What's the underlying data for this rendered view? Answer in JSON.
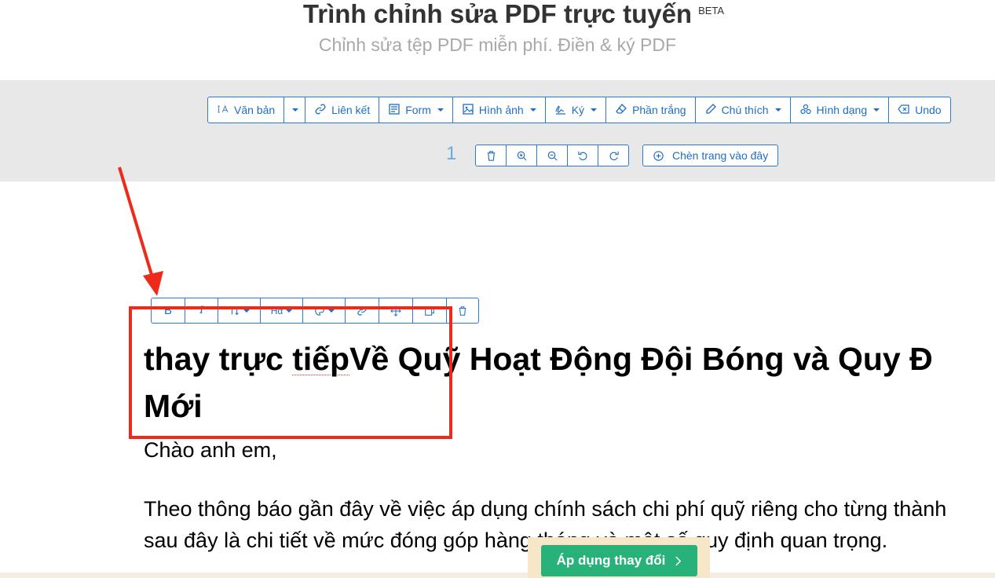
{
  "header": {
    "title": "Trình chỉnh sửa PDF trực tuyến",
    "beta": "BETA",
    "subtitle": "Chỉnh sửa tệp PDF miễn phí. Điền & ký PDF"
  },
  "toolbar": {
    "items": [
      {
        "label": "Văn bản",
        "icon": "text-cursor-icon"
      },
      {
        "label": "",
        "icon": "chevron-down-icon"
      },
      {
        "label": "Liên kết",
        "icon": "link-icon"
      },
      {
        "label": "Form",
        "icon": "form-icon"
      },
      {
        "label": "Hình ảnh",
        "icon": "image-icon"
      },
      {
        "label": "Ký",
        "icon": "signature-icon"
      },
      {
        "label": "Phần trắng",
        "icon": "eraser-icon"
      },
      {
        "label": "Chú thích",
        "icon": "pen-icon"
      },
      {
        "label": "Hình dạng",
        "icon": "shapes-icon"
      },
      {
        "label": "Undo",
        "icon": "backspace-icon"
      }
    ]
  },
  "page_controls": {
    "page_number": "1",
    "insert_label": "Chèn trang vào đây"
  },
  "text_toolbar": {
    "bold": "B",
    "italic": "I",
    "size_label": "Hα"
  },
  "document": {
    "heading_line1_a": " thay trực ",
    "heading_line1_b": "tiếp",
    "heading_line1_c": "Về Quỹ Hoạt Động Đội Bóng và Quy Đ",
    "heading_line2": "Mới",
    "greeting": "Chào anh em,",
    "para_line1": "Theo thông báo gần đây về việc áp dụng chính sách chi phí quỹ riêng cho từng thành",
    "para_line2": "sau đây là chi tiết về mức đóng góp hàng tháng và một số quy định quan trọng."
  },
  "apply_button": "Áp dụng thay đổi",
  "colors": {
    "accent": "#1e6dc4",
    "annotation": "#ee2a1b",
    "apply": "#28b27a"
  }
}
